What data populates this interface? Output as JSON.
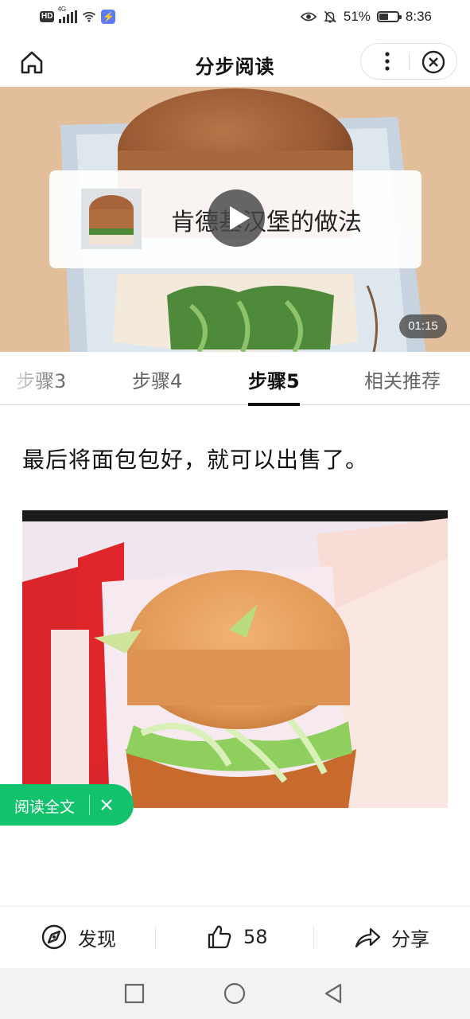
{
  "status_bar": {
    "hd_label": "HD",
    "network_label": "4G",
    "battery_percent": "51%",
    "battery_level": 0.51,
    "time": "8:36"
  },
  "nav": {
    "title": "分步阅读",
    "home_icon": "home-icon",
    "more_icon": "more-vertical-icon",
    "close_icon": "close-circle-icon"
  },
  "video": {
    "title": "肯德基汉堡的做法",
    "duration": "01:15",
    "play_icon": "play-icon"
  },
  "tabs": [
    {
      "label": "步骤3",
      "active": false
    },
    {
      "label": "步骤4",
      "active": false
    },
    {
      "label": "步骤5",
      "active": true
    },
    {
      "label": "相关推荐",
      "active": false
    }
  ],
  "step": {
    "text": "最后将面包包好，就可以出售了。"
  },
  "read_full": {
    "label": "阅读全文"
  },
  "bottom_bar": {
    "discover_label": "发现",
    "likes_count": "58",
    "share_label": "分享"
  },
  "colors": {
    "accent_green": "#13c26d",
    "text_primary": "#111111",
    "tab_inactive": "#666666"
  }
}
